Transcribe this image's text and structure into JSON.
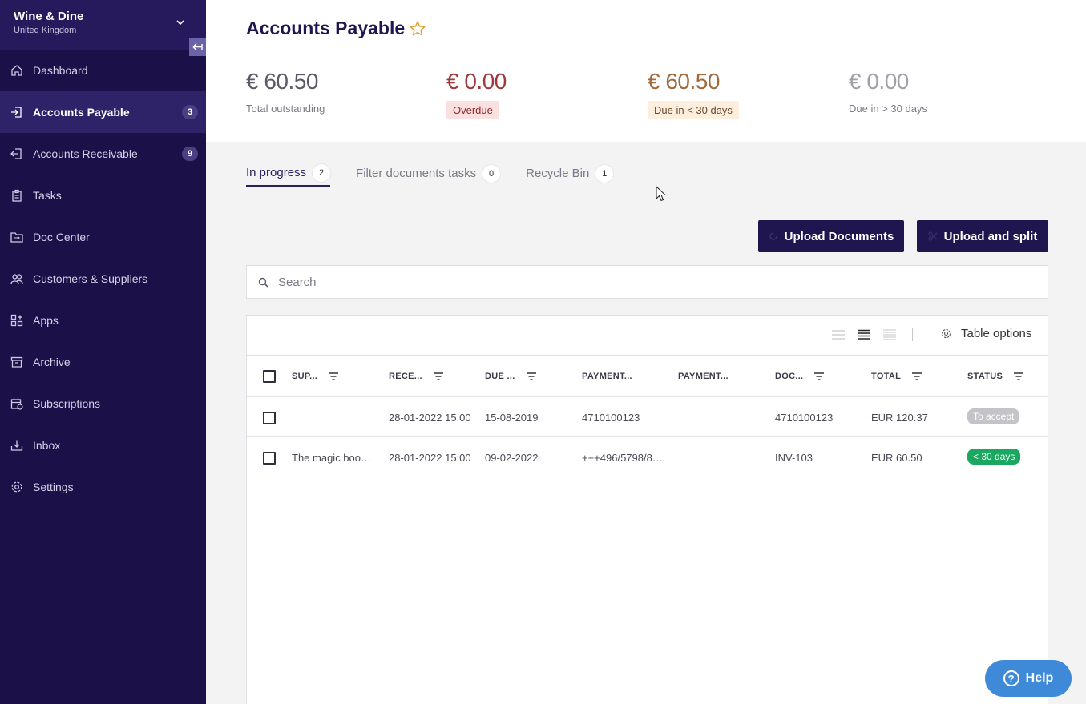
{
  "company": {
    "name": "Wine & Dine",
    "country": "United Kingdom"
  },
  "sidebar": {
    "items": [
      {
        "label": "Dashboard",
        "icon": "home-icon"
      },
      {
        "label": "Accounts Payable",
        "icon": "login-icon",
        "badge": "3",
        "active": true
      },
      {
        "label": "Accounts Receivable",
        "icon": "logout-icon",
        "badge": "9"
      },
      {
        "label": "Tasks",
        "icon": "clipboard-icon"
      },
      {
        "label": "Doc Center",
        "icon": "folder-transfer-icon"
      },
      {
        "label": "Customers & Suppliers",
        "icon": "users-icon"
      },
      {
        "label": "Apps",
        "icon": "apps-grid-icon"
      },
      {
        "label": "Archive",
        "icon": "archive-icon"
      },
      {
        "label": "Subscriptions",
        "icon": "calendar-icon"
      },
      {
        "label": "Inbox",
        "icon": "inbox-download-icon"
      },
      {
        "label": "Settings",
        "icon": "gear-icon"
      }
    ]
  },
  "header": {
    "title": "Accounts Payable",
    "stats": [
      {
        "amount": "€ 60.50",
        "label": "Total outstanding"
      },
      {
        "amount": "€ 0.00",
        "label": "Overdue"
      },
      {
        "amount": "€ 60.50",
        "label": "Due in < 30 days"
      },
      {
        "amount": "€ 0.00",
        "label": "Due in > 30 days"
      }
    ]
  },
  "tabs": [
    {
      "label": "In progress",
      "count": "2"
    },
    {
      "label": "Filter documents tasks",
      "count": "0"
    },
    {
      "label": "Recycle Bin",
      "count": "1"
    }
  ],
  "actions": {
    "upload": "Upload Documents",
    "split": "Upload and split"
  },
  "search": {
    "placeholder": "Search"
  },
  "table": {
    "options_label": "Table options",
    "columns": [
      "SUP...",
      "RECE...",
      "DUE ...",
      "PAYMENT...",
      "PAYMENT...",
      "DOC...",
      "TOTAL",
      "STATUS"
    ],
    "rows": [
      {
        "supplier": "",
        "received": "28-01-2022 15:00",
        "due": "15-08-2019",
        "payment1": "4710100123",
        "payment2": "",
        "doc": "4710100123",
        "total": "EUR 120.37",
        "status": "To accept"
      },
      {
        "supplier": "The magic boo…",
        "received": "28-01-2022 15:00",
        "due": "09-02-2022",
        "payment1": "+++496/5798/8…",
        "payment2": "",
        "doc": "INV-103",
        "total": "EUR 60.50",
        "status": "< 30 days"
      }
    ]
  },
  "help": {
    "label": "Help"
  },
  "colors": {
    "sidebar": "#1b1148",
    "primary": "#1f1650",
    "success": "#1aa760",
    "help": "#3f8ad8"
  }
}
